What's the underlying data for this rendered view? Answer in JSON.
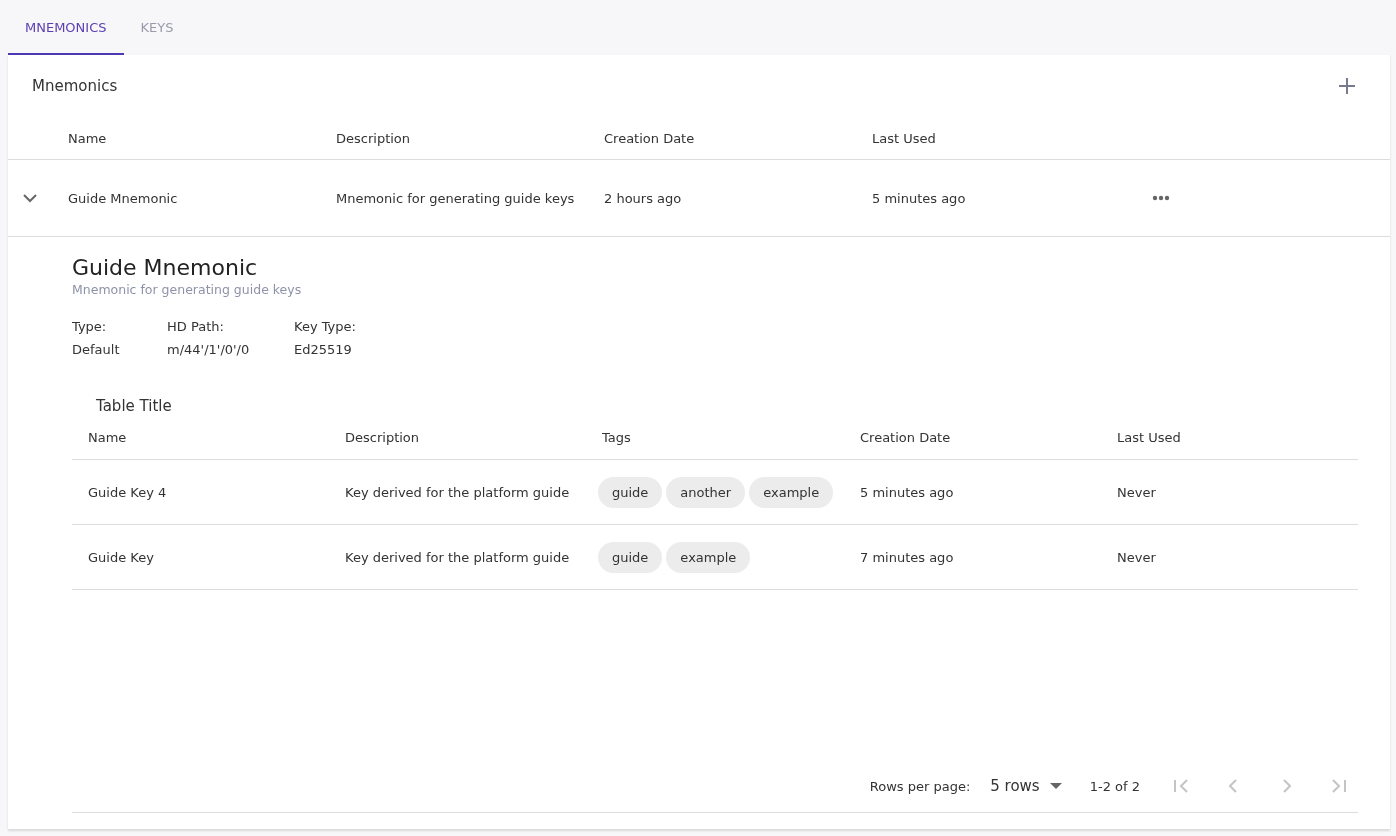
{
  "tabs": [
    {
      "label": "MNEMONICS",
      "selected": true
    },
    {
      "label": "KEYS",
      "selected": false
    }
  ],
  "card": {
    "title": "Mnemonics",
    "columns": [
      "Name",
      "Description",
      "Creation Date",
      "Last Used"
    ],
    "rows": [
      {
        "expanded": true,
        "name": "Guide Mnemonic",
        "description": "Mnemonic for generating guide keys",
        "created": "2 hours ago",
        "last_used": "5 minutes ago",
        "detail": {
          "title": "Guide Mnemonic",
          "subtitle": "Mnemonic for generating guide keys",
          "fields": [
            {
              "label": "Type:",
              "value": "Default"
            },
            {
              "label": "HD Path:",
              "value": "m/44'/1'/0'/0"
            },
            {
              "label": "Key Type:",
              "value": "Ed25519"
            }
          ],
          "table": {
            "title": "Table Title",
            "columns": [
              "Name",
              "Description",
              "Tags",
              "Creation Date",
              "Last Used"
            ],
            "rows": [
              {
                "name": "Guide Key 4",
                "description": "Key derived for the platform guide",
                "tags": [
                  "guide",
                  "another",
                  "example"
                ],
                "created": "5 minutes ago",
                "last_used": "Never"
              },
              {
                "name": "Guide Key",
                "description": "Key derived for the platform guide",
                "tags": [
                  "guide",
                  "example"
                ],
                "created": "7 minutes ago",
                "last_used": "Never"
              }
            ],
            "pagination": {
              "rows_label": "Rows per page:",
              "rows_value": "5 rows",
              "range": "1-2 of 2",
              "buttons": [
                {
                  "kind": "first",
                  "disabled": true
                },
                {
                  "kind": "prev",
                  "disabled": true
                },
                {
                  "kind": "next",
                  "disabled": true
                },
                {
                  "kind": "last",
                  "disabled": true
                }
              ]
            }
          }
        }
      }
    ]
  }
}
